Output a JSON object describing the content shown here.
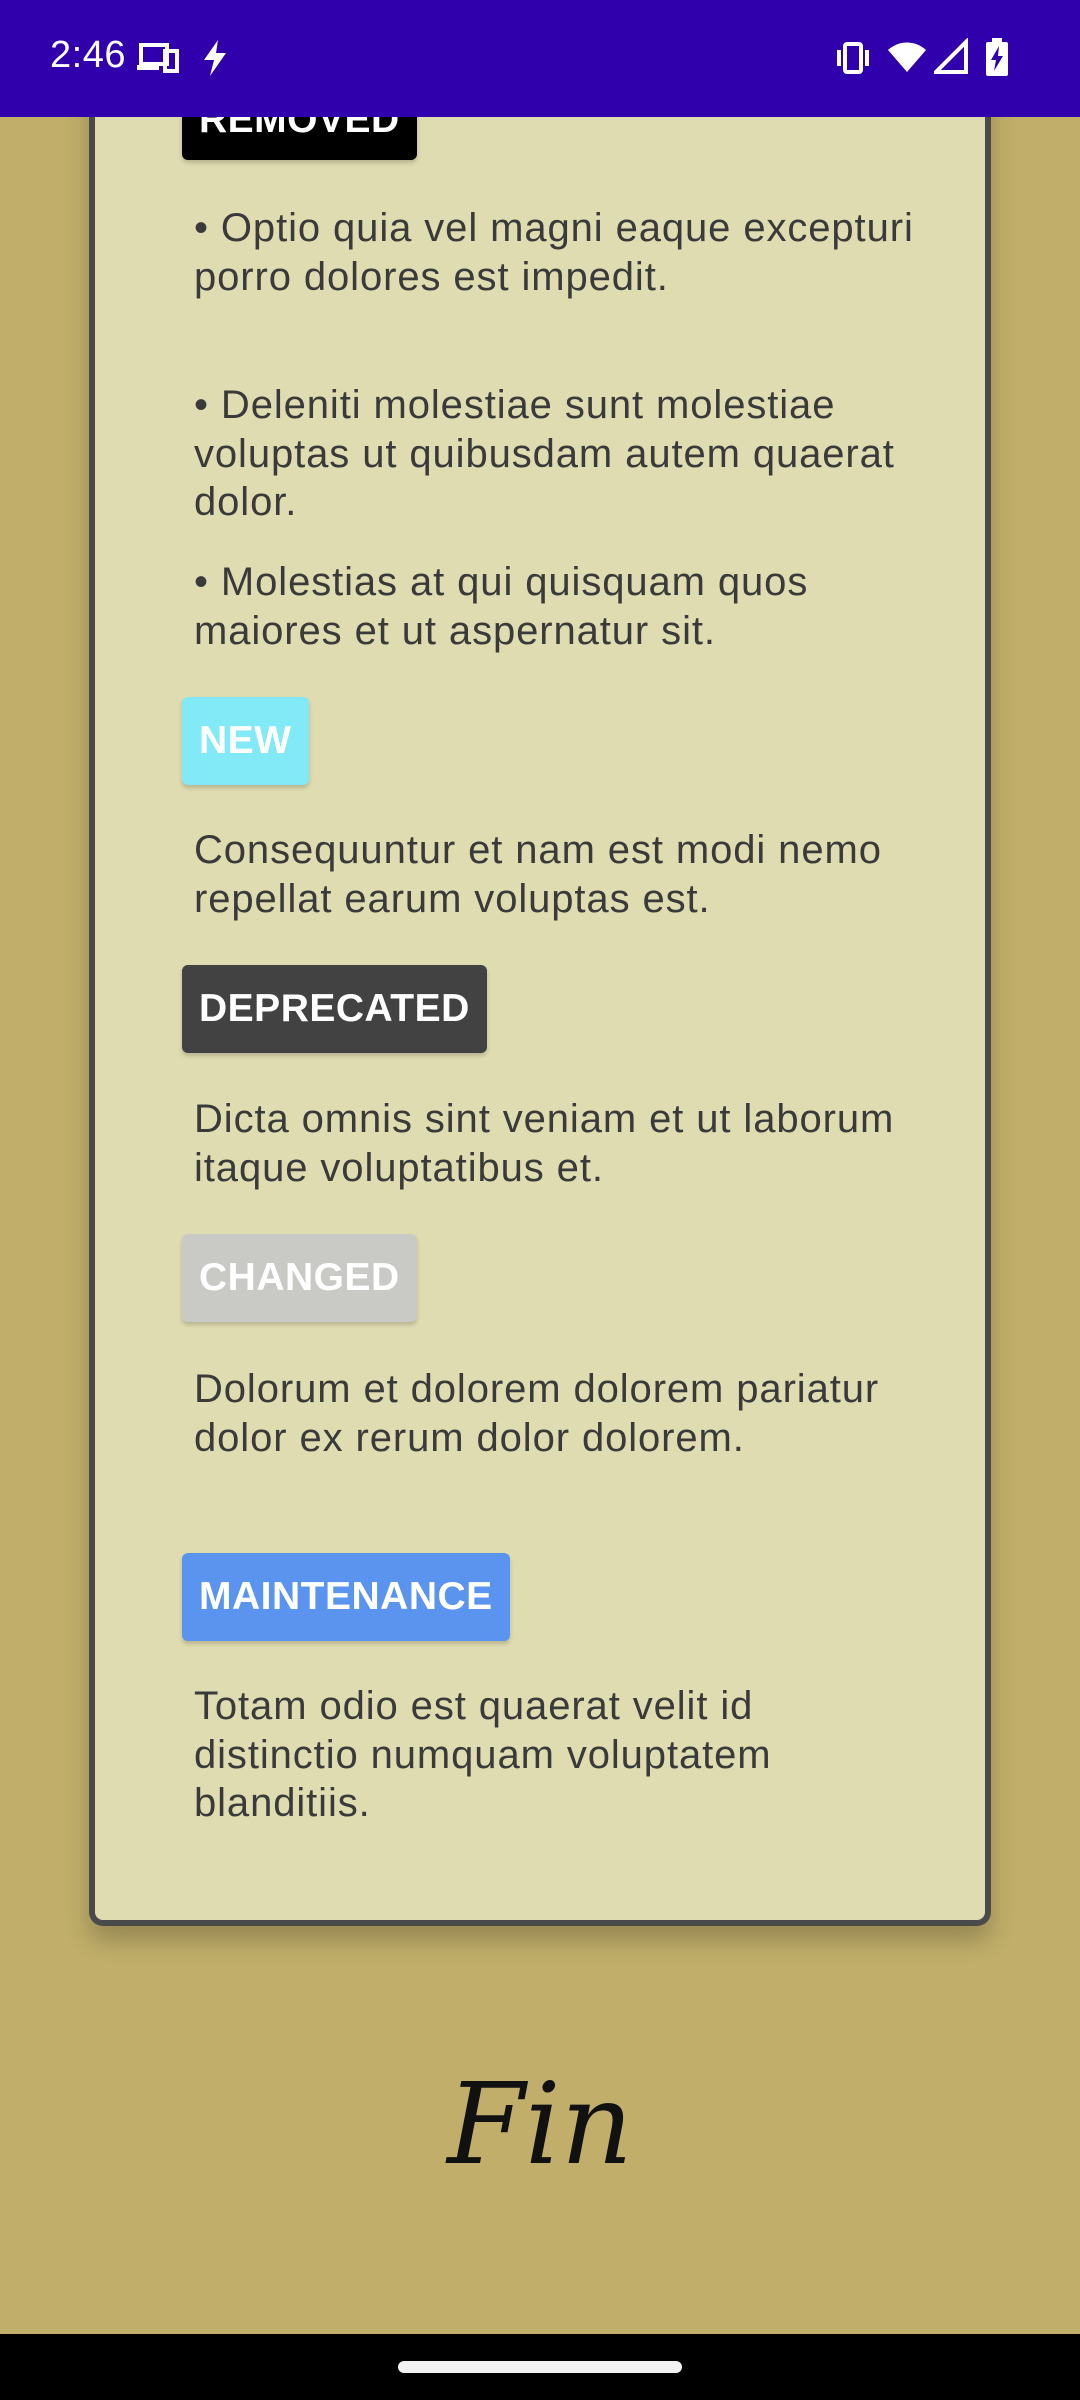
{
  "status_bar": {
    "time": "2:46",
    "icons": [
      "devices-icon",
      "flash-icon",
      "vibrate-icon",
      "wifi-icon",
      "signal-icon",
      "battery-charging-icon"
    ],
    "background": "#3000ad"
  },
  "card": {
    "sections": [
      {
        "badge": "REMOVED",
        "badge_color": "#000000",
        "items": [
          "• Optio quia vel magni eaque excepturi porro dolores est impedit.",
          "• Deleniti molestiae sunt molestiae voluptas ut quibusdam autem quaerat dolor.",
          "• Molestias at qui quisquam quos maiores et ut aspernatur sit."
        ]
      },
      {
        "badge": "NEW",
        "badge_color": "#82e9f7",
        "text": "Consequuntur et nam est modi nemo repellat earum voluptas est."
      },
      {
        "badge": "DEPRECATED",
        "badge_color": "#424242",
        "text": "Dicta omnis sint veniam et ut laborum itaque voluptatibus et."
      },
      {
        "badge": "CHANGED",
        "badge_color": "#c9c9c5",
        "text": "Dolorum et dolorem dolorem pariatur dolor ex rerum dolor dolorem."
      },
      {
        "badge": "MAINTENANCE",
        "badge_color": "#5a94ef",
        "text": "Totam odio est quaerat velit id distinctio numquam voluptatem blanditiis."
      }
    ]
  },
  "footer": {
    "text": "Fin"
  },
  "colors": {
    "page_background": "#c0ae6a",
    "card_background": "#e0dcb1",
    "card_border": "#4a4a4a"
  }
}
